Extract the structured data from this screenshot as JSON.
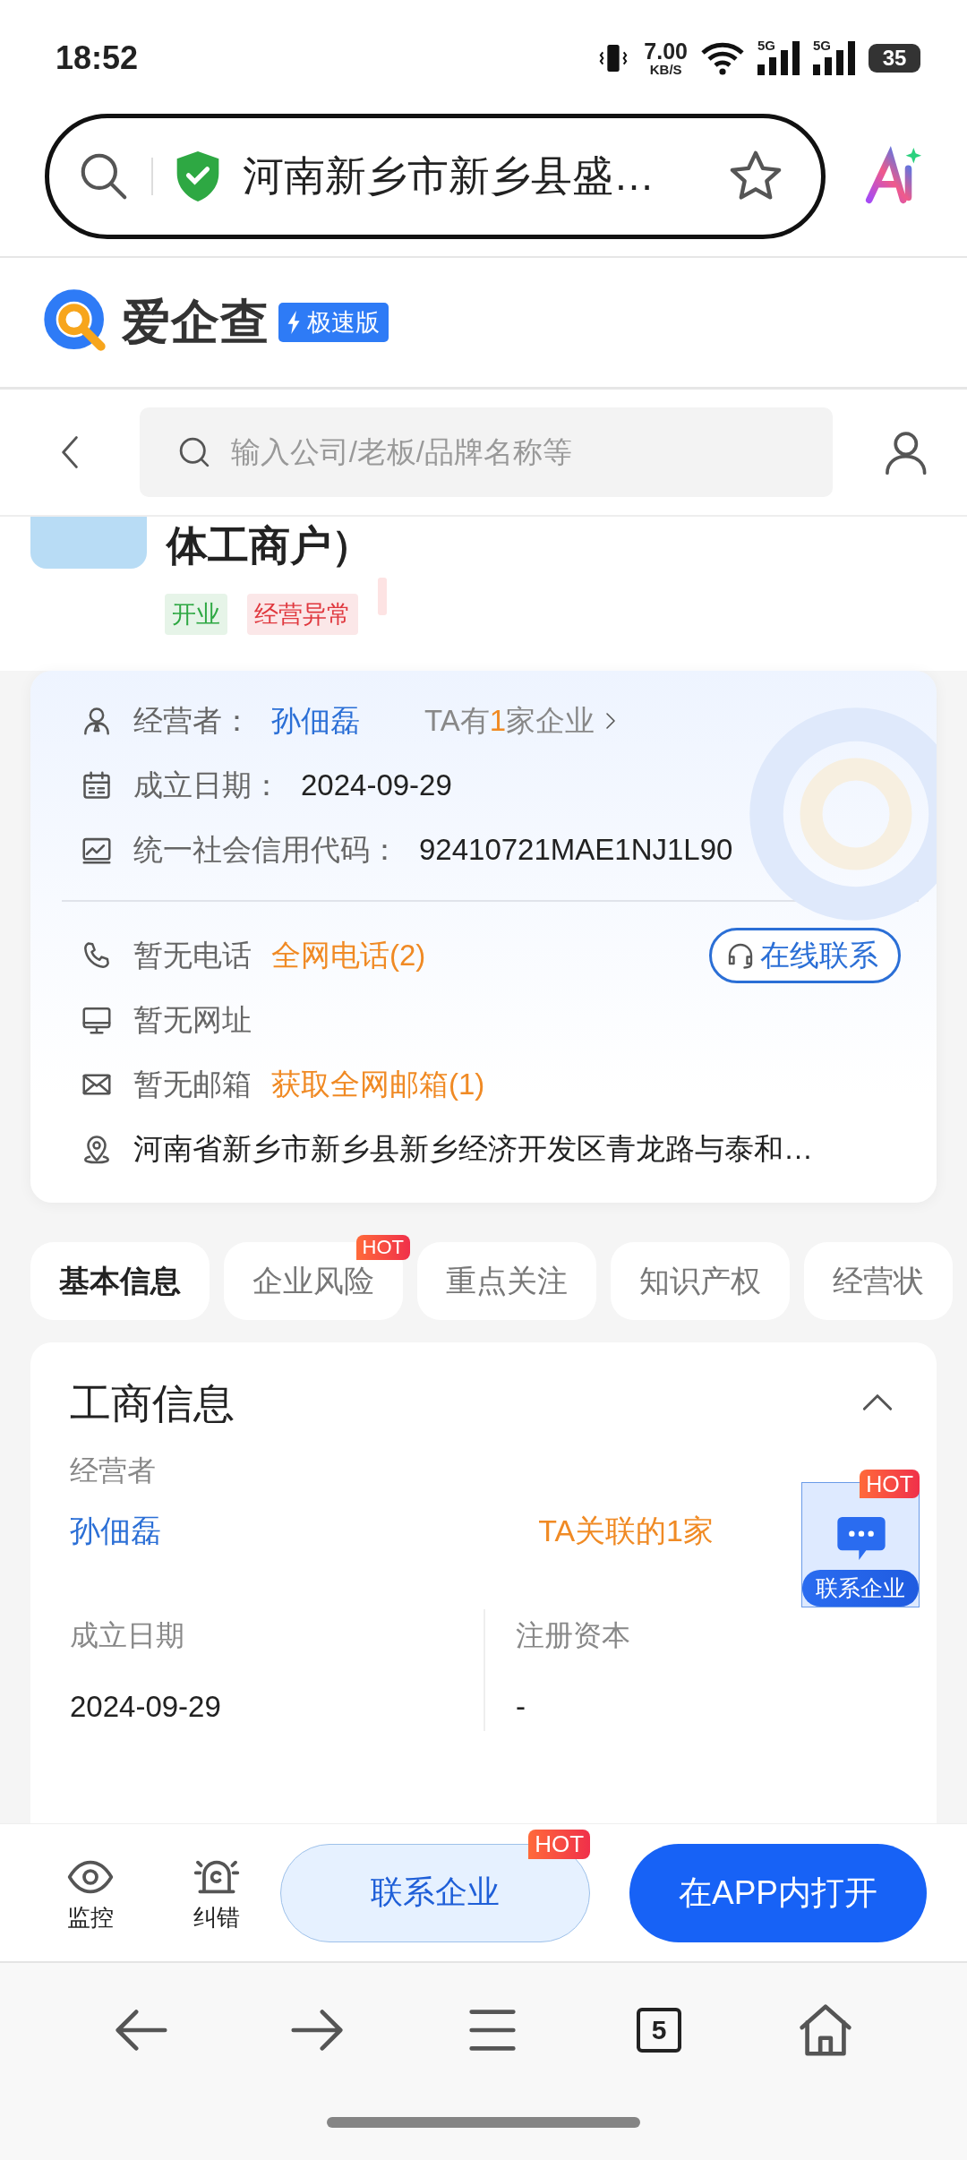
{
  "status_bar": {
    "time": "18:52",
    "net_speed": {
      "value": "7.00",
      "unit": "KB/S"
    },
    "signals": [
      {
        "label": "5G"
      },
      {
        "label": "5G"
      }
    ],
    "battery": "35"
  },
  "address_bar": {
    "text": "河南新乡市新乡县盛…"
  },
  "site_header": {
    "logo_text": "爱企查",
    "edition": "极速版"
  },
  "nav": {
    "search_placeholder": "输入公司/老板/品牌名称等"
  },
  "company": {
    "title": "体工商户）",
    "tags": [
      {
        "label": "开业",
        "color": "#2ea843"
      },
      {
        "label": "经营异常",
        "color": "#e0383e"
      }
    ]
  },
  "info_card": {
    "operator": {
      "label": "经营者：",
      "name": "孙佃磊",
      "related_before": "TA有",
      "related_count": "1",
      "related_after": "家企业"
    },
    "rows": [
      {
        "kind": "calendar",
        "label": "成立日期：",
        "value": "2024-09-29"
      },
      {
        "kind": "chart",
        "label": "统一社会信用代码：",
        "value": "92410721MAE1NJ1L90"
      }
    ],
    "contacts": [
      {
        "kind": "phone",
        "text": "暂无电话",
        "link": "全网电话(2)"
      },
      {
        "kind": "monitor",
        "text": "暂无网址"
      },
      {
        "kind": "mail",
        "text": "暂无邮箱",
        "link": "获取全网邮箱(1)"
      },
      {
        "kind": "pin",
        "text": "河南省新乡市新乡县新乡经济开发区青龙路与泰和…"
      }
    ],
    "online_button": "在线联系"
  },
  "tabs": [
    {
      "label": "基本信息",
      "selected": true
    },
    {
      "label": "企业风险",
      "selected": false,
      "badge": "HOT"
    },
    {
      "label": "重点关注",
      "selected": false
    },
    {
      "label": "知识产权",
      "selected": false
    },
    {
      "label": "经营状",
      "selected": false
    }
  ],
  "section": {
    "title": "工商信息",
    "expanded": true,
    "operator": {
      "label": "经营者",
      "name": "孙佃磊",
      "related": "TA关联的1家"
    },
    "fields": [
      {
        "label": "成立日期",
        "value": "2024-09-29"
      },
      {
        "label": "注册资本",
        "value": "-"
      }
    ]
  },
  "floating_widget": {
    "badge": "HOT",
    "label": "联系企业"
  },
  "action_bar": {
    "tools": [
      {
        "kind": "eye",
        "label": "监控"
      },
      {
        "kind": "alarm",
        "label": "纠错"
      }
    ],
    "contact_button": {
      "label": "联系企业",
      "badge": "HOT"
    },
    "open_button": "在APP内打开"
  },
  "browser_toolbar": {
    "tab_count": "5"
  }
}
